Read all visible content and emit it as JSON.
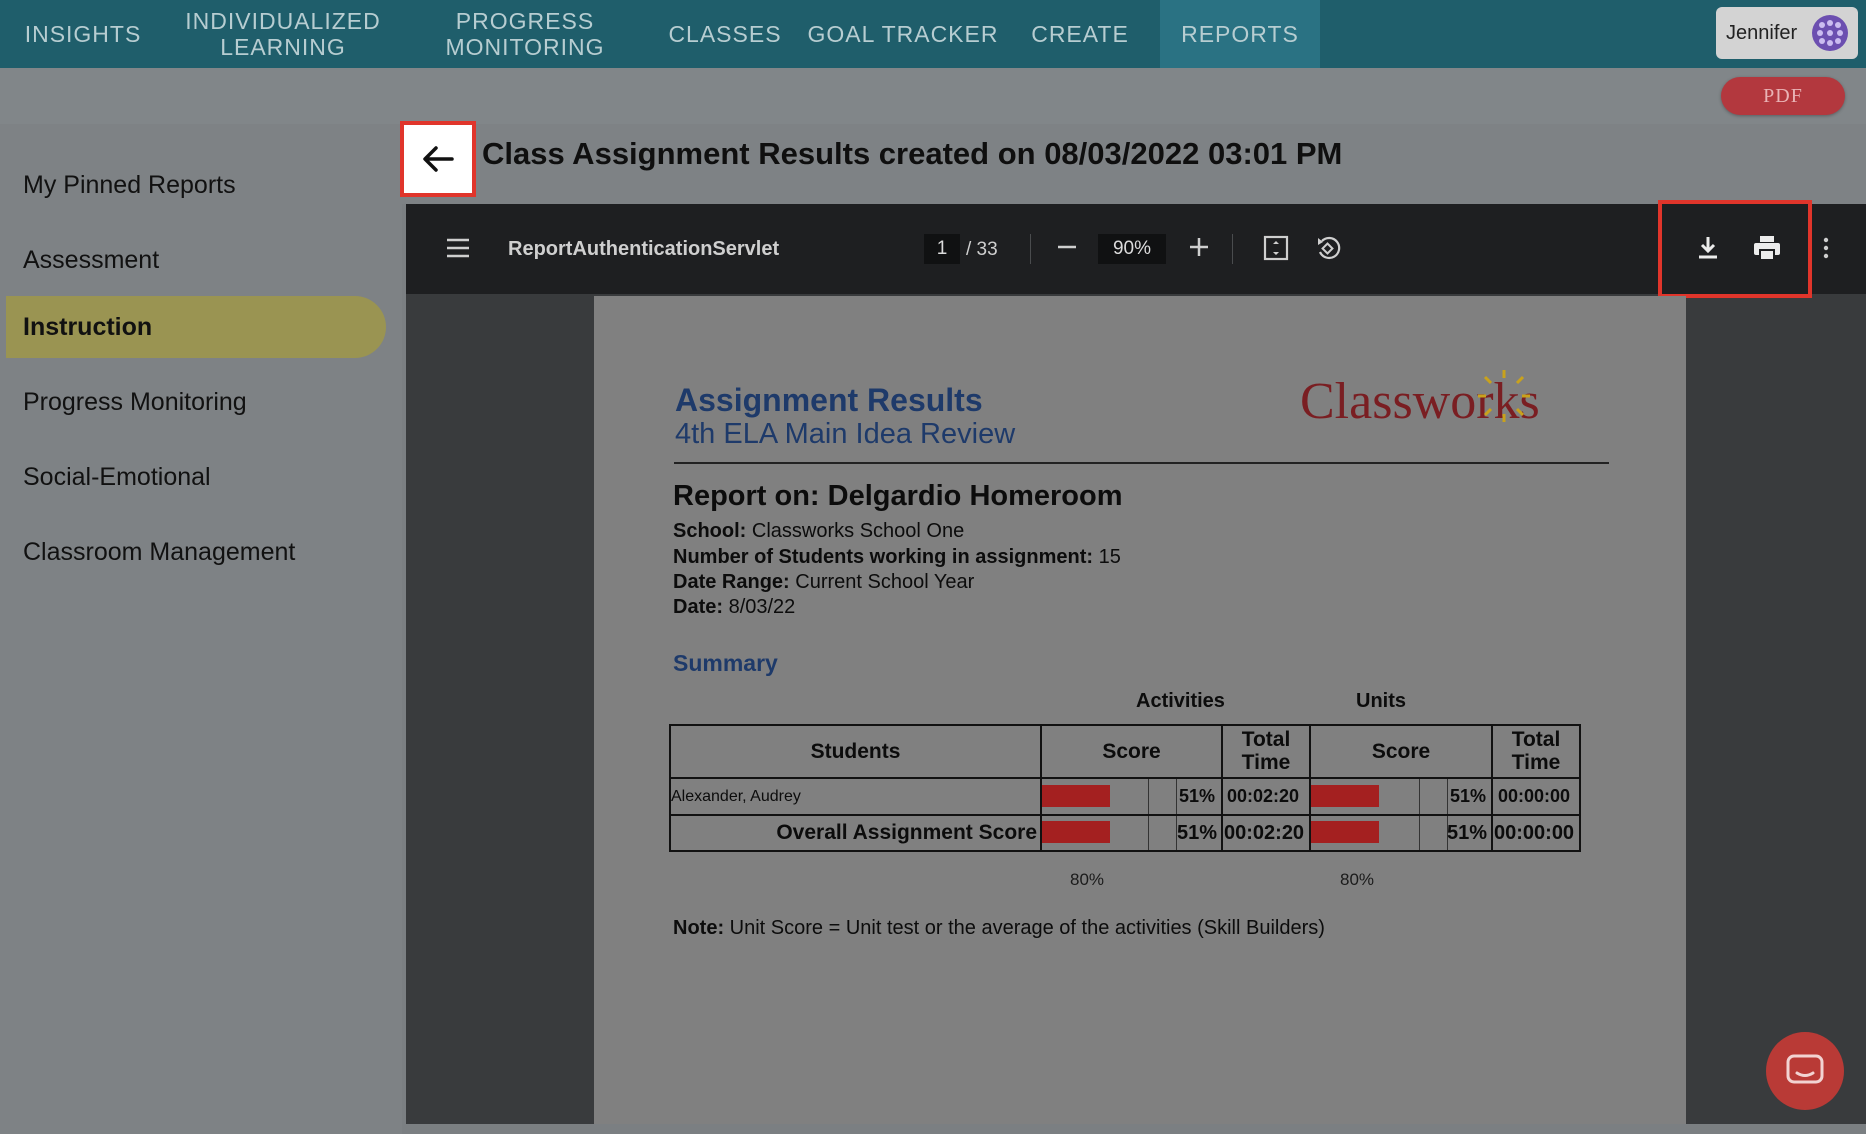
{
  "nav": {
    "items": [
      {
        "label": "INSIGHTS"
      },
      {
        "label": "INDIVIDUALIZED\nLEARNING"
      },
      {
        "label": "PROGRESS\nMONITORING"
      },
      {
        "label": "CLASSES"
      },
      {
        "label": "GOAL TRACKER"
      },
      {
        "label": "CREATE"
      },
      {
        "label": "REPORTS",
        "active": true
      }
    ],
    "user_name": "Jennifer"
  },
  "subbar": {
    "pdf_label": "PDF"
  },
  "sidebar": {
    "items": [
      {
        "label": "My Pinned Reports"
      },
      {
        "label": "Assessment"
      },
      {
        "label": "Instruction",
        "active": true
      },
      {
        "label": "Progress Monitoring"
      },
      {
        "label": "Social-Emotional"
      },
      {
        "label": "Classroom Management"
      }
    ]
  },
  "page": {
    "title": "Class Assignment Results created on 08/03/2022 03:01 PM"
  },
  "viewer": {
    "doc_name": "ReportAuthenticationServlet",
    "current_page": "1",
    "page_total": "/ 33",
    "zoom": "90%"
  },
  "report": {
    "title": "Assignment Results",
    "subtitle": "4th ELA Main Idea Review",
    "logo_text": "Classworks",
    "report_on": "Report on: Delgardio Homeroom",
    "meta": [
      {
        "label": "School:",
        "value": " Classworks School One"
      },
      {
        "label": "Number of Students working in assignment:",
        "value": " 15"
      },
      {
        "label": "Date Range:",
        "value": " Current School Year"
      },
      {
        "label": "Date:",
        "value": " 8/03/22"
      }
    ],
    "summary_heading": "Summary",
    "group_activities": "Activities",
    "group_units": "Units",
    "headers": {
      "students": "Students",
      "score": "Score",
      "total_time": "Total\nTime"
    },
    "rows": [
      {
        "student": "Alexander, Audrey",
        "activity_score": 0.51,
        "activity_pct": "51%",
        "activity_time": "00:02:20",
        "unit_score": 0.51,
        "unit_pct": "51%",
        "unit_time": "00:00:00"
      }
    ],
    "overall": {
      "label": "Overall Assignment Score",
      "activity_score": 0.51,
      "activity_pct": "51%",
      "activity_time": "00:02:20",
      "unit_score": 0.51,
      "unit_pct": "51%",
      "unit_time": "00:00:00"
    },
    "target_activities": "80%",
    "target_units": "80%",
    "note_label": "Note:",
    "note_text": " Unit Score = Unit test or the average of the activities (Skill Builders)"
  },
  "colors": {
    "nav_bg": "#1f5e6b",
    "nav_active": "#2a7283",
    "sidebar_active": "#9a9452",
    "pdf_button": "#b3383e",
    "highlight_border": "#e0352b",
    "score_bar": "#a42020",
    "report_blue": "#1e3a6a"
  },
  "icons": [
    "back-arrow-icon",
    "menu-icon",
    "zoom-out-icon",
    "zoom-in-icon",
    "fit-page-icon",
    "rotate-icon",
    "download-icon",
    "print-icon",
    "more-vertical-icon",
    "chat-icon",
    "user-avatar-icon",
    "logo-sun-icon"
  ]
}
